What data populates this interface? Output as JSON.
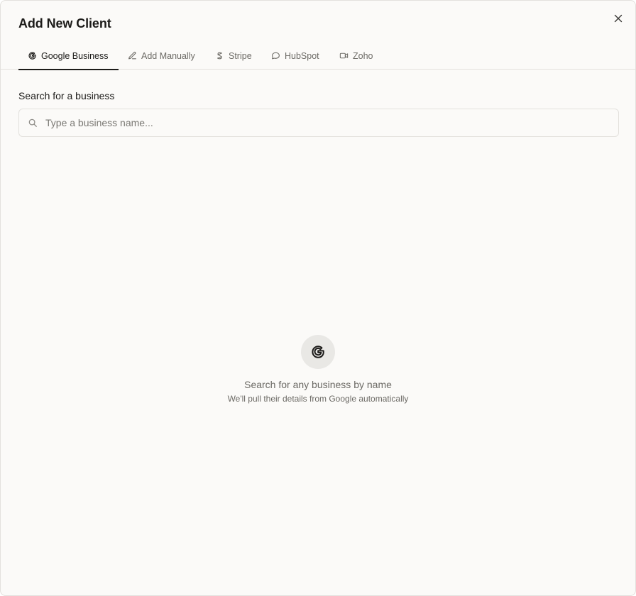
{
  "dialog": {
    "title": "Add New Client",
    "close_icon": "close-icon"
  },
  "tabs": [
    {
      "label": "Google Business",
      "icon": "google-icon",
      "active": true
    },
    {
      "label": "Add Manually",
      "icon": "pencil-icon",
      "active": false
    },
    {
      "label": "Stripe",
      "icon": "stripe-icon",
      "active": false
    },
    {
      "label": "HubSpot",
      "icon": "chat-bubble-icon",
      "active": false
    },
    {
      "label": "Zoho",
      "icon": "video-icon",
      "active": false
    }
  ],
  "search": {
    "label": "Search for a business",
    "placeholder": "Type a business name...",
    "value": "",
    "icon": "search-icon"
  },
  "empty_state": {
    "icon": "google-icon",
    "title": "Search for any business by name",
    "subtitle": "We'll pull their details from Google automatically"
  },
  "colors": {
    "background": "#fbfaf8",
    "text": "#1c1b19",
    "muted_text": "#6c6a65",
    "border": "#e3e1dd",
    "icon_circle": "#e9e8e5"
  }
}
